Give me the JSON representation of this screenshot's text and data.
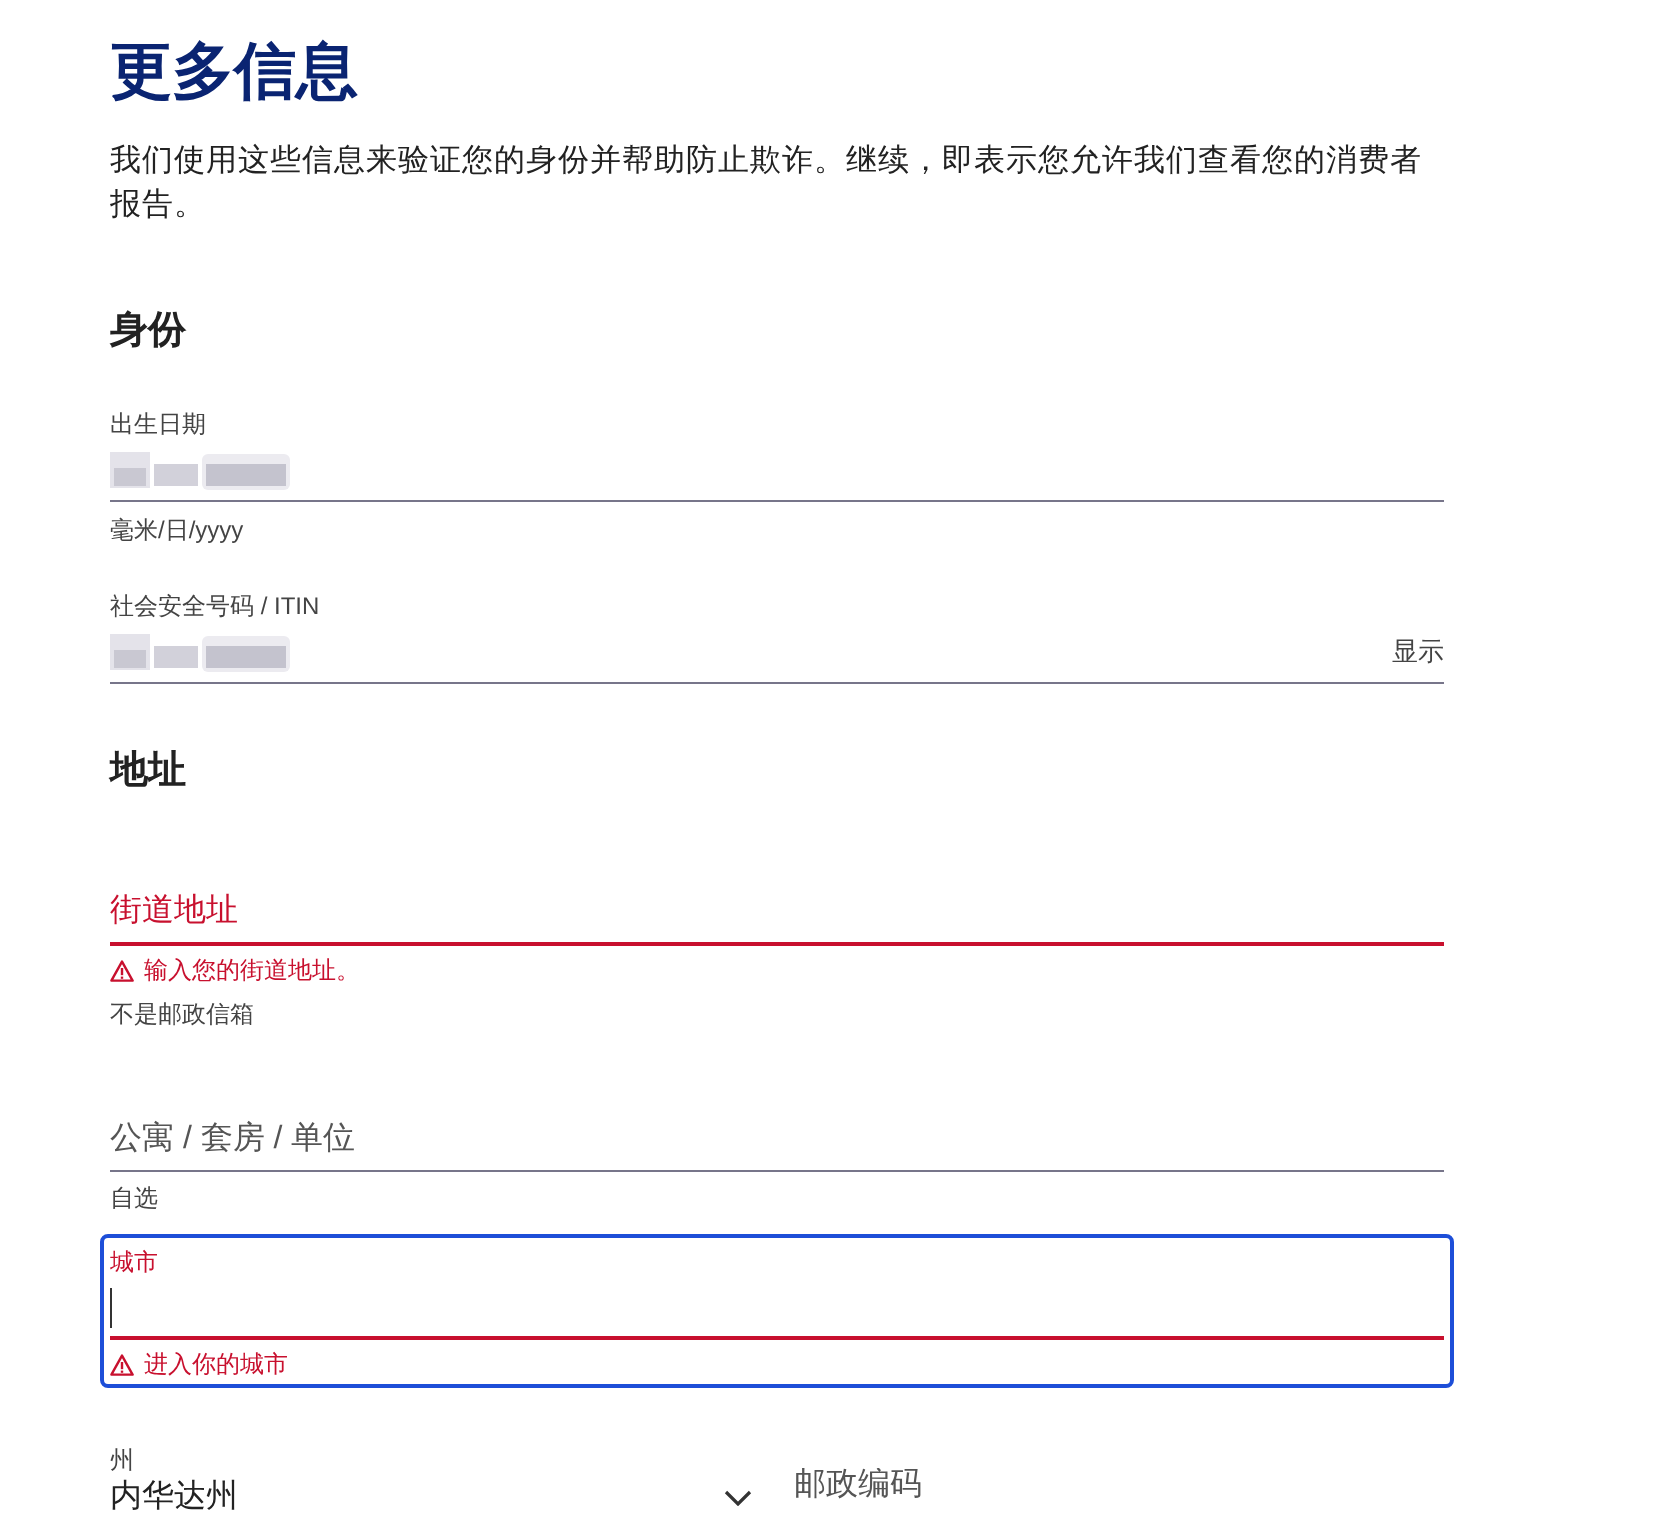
{
  "title": "更多信息",
  "intro": "我们使用这些信息来验证您的身份并帮助防止欺诈。继续，即表示您允许我们查看您的消费者报告。",
  "sections": [
    {
      "heading": "身份",
      "fields": [
        {
          "kind": "masked",
          "label": "出生日期",
          "hint": "毫米/日/yyyy"
        },
        {
          "kind": "masked",
          "label": "社会安全号码 / ITIN",
          "action": "显示"
        }
      ]
    },
    {
      "heading": "地址",
      "fields": [
        {
          "kind": "text",
          "placeholder": "街道地址",
          "error": "输入您的街道地址。",
          "hint": "不是邮政信箱"
        },
        {
          "kind": "text",
          "placeholder": "公寓 / 套房 / 单位",
          "hint": "自选"
        },
        {
          "kind": "text",
          "label": "城市",
          "focused": true,
          "error": "进入你的城市"
        }
      ]
    }
  ],
  "bottom_row": {
    "state": {
      "label": "州",
      "value": "内华达州"
    },
    "zip": {
      "placeholder": "邮政编码"
    }
  }
}
